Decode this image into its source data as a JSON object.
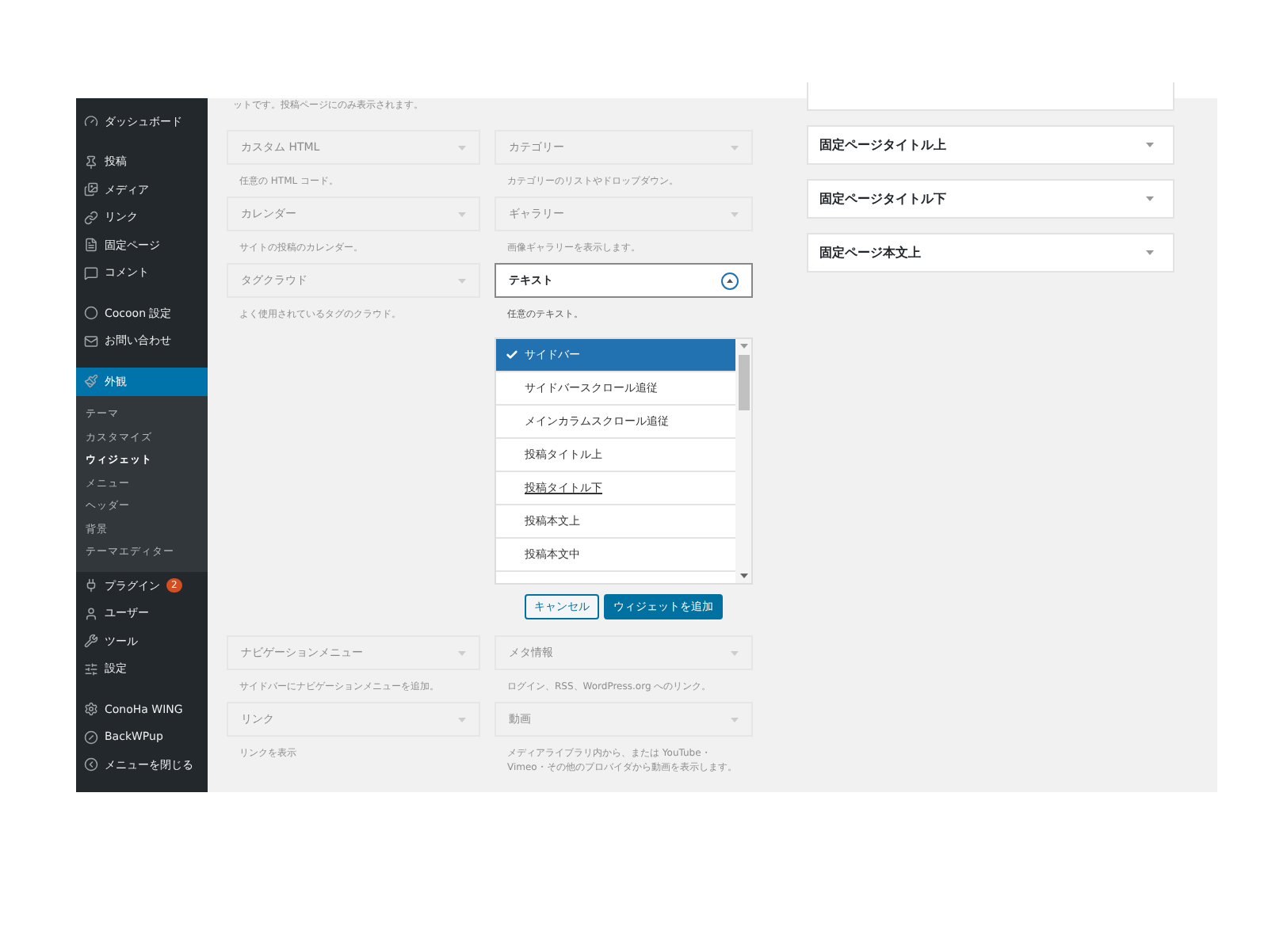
{
  "sidebar": {
    "groups": [
      [
        {
          "label": "ダッシュボード",
          "selected": false
        }
      ],
      [
        {
          "label": "投稿",
          "selected": false
        },
        {
          "label": "メディア",
          "selected": false
        },
        {
          "label": "リンク",
          "selected": false
        },
        {
          "label": "固定ページ",
          "selected": false
        },
        {
          "label": "コメント",
          "selected": false
        }
      ],
      [
        {
          "label": "Cocoon 設定",
          "selected": false
        },
        {
          "label": "お問い合わせ",
          "selected": false
        }
      ],
      [
        {
          "label": "外観",
          "selected": true,
          "children": [
            {
              "label": "テーマ",
              "selected": false
            },
            {
              "label": "カスタマイズ",
              "selected": false
            },
            {
              "label": "ウィジェット",
              "selected": true
            },
            {
              "label": "メニュー",
              "selected": false
            },
            {
              "label": "ヘッダー",
              "selected": false
            },
            {
              "label": "背景",
              "selected": false
            },
            {
              "label": "テーマエディター",
              "selected": false
            }
          ]
        },
        {
          "label": "プラグイン",
          "selected": false,
          "badge": "2"
        },
        {
          "label": "ユーザー",
          "selected": false
        },
        {
          "label": "ツール",
          "selected": false
        },
        {
          "label": "設定",
          "selected": false
        }
      ],
      [
        {
          "label": "ConoHa WING",
          "selected": false
        },
        {
          "label": "BackWPup",
          "selected": false
        },
        {
          "label": "メニューを閉じる",
          "selected": false
        }
      ]
    ]
  },
  "top_note": "ットです。投稿ページにのみ表示されます。",
  "widgets": [
    {
      "title": "カスタム HTML",
      "description": "任意の HTML コード。",
      "expanded": false
    },
    {
      "title": "カテゴリー",
      "description": "カテゴリーのリストやドロップダウン。",
      "expanded": false
    },
    {
      "title": "カレンダー",
      "description": "サイトの投稿のカレンダー。",
      "expanded": false
    },
    {
      "title": "ギャラリー",
      "description": "画像ギャラリーを表示します。",
      "expanded": false
    },
    {
      "title": "タグクラウド",
      "description": "よく使用されているタグのクラウド。",
      "expanded": false
    },
    {
      "title": "テキスト",
      "description": "任意のテキスト。",
      "expanded": true,
      "areas": [
        {
          "label": "サイドバー",
          "selected": true,
          "hovered": false
        },
        {
          "label": "サイドバースクロール追従",
          "selected": false,
          "hovered": false
        },
        {
          "label": "メインカラムスクロール追従",
          "selected": false,
          "hovered": false
        },
        {
          "label": "投稿タイトル上",
          "selected": false,
          "hovered": false
        },
        {
          "label": "投稿タイトル下",
          "selected": false,
          "hovered": true
        },
        {
          "label": "投稿本文上",
          "selected": false,
          "hovered": false
        },
        {
          "label": "投稿本文中",
          "selected": false,
          "hovered": false
        }
      ],
      "cancel_button": "キャンセル",
      "add_button": "ウィジェットを追加"
    },
    {
      "title": "ナビゲーションメニュー",
      "description": "サイドバーにナビゲーションメニューを追加。",
      "expanded": false
    },
    {
      "title": "メタ情報",
      "description": "ログイン、RSS、WordPress.org へのリンク。",
      "expanded": false
    },
    {
      "title": "リンク",
      "description": "リンクを表示",
      "expanded": false
    },
    {
      "title": "動画",
      "description": "メディアライブラリ内から、または YouTube・Vimeo・その他のプロバイダから動画を表示します。",
      "expanded": false
    }
  ],
  "areas_panel": [
    {
      "title": "固定ページタイトル上"
    },
    {
      "title": "固定ページタイトル下"
    },
    {
      "title": "固定ページ本文上"
    }
  ]
}
